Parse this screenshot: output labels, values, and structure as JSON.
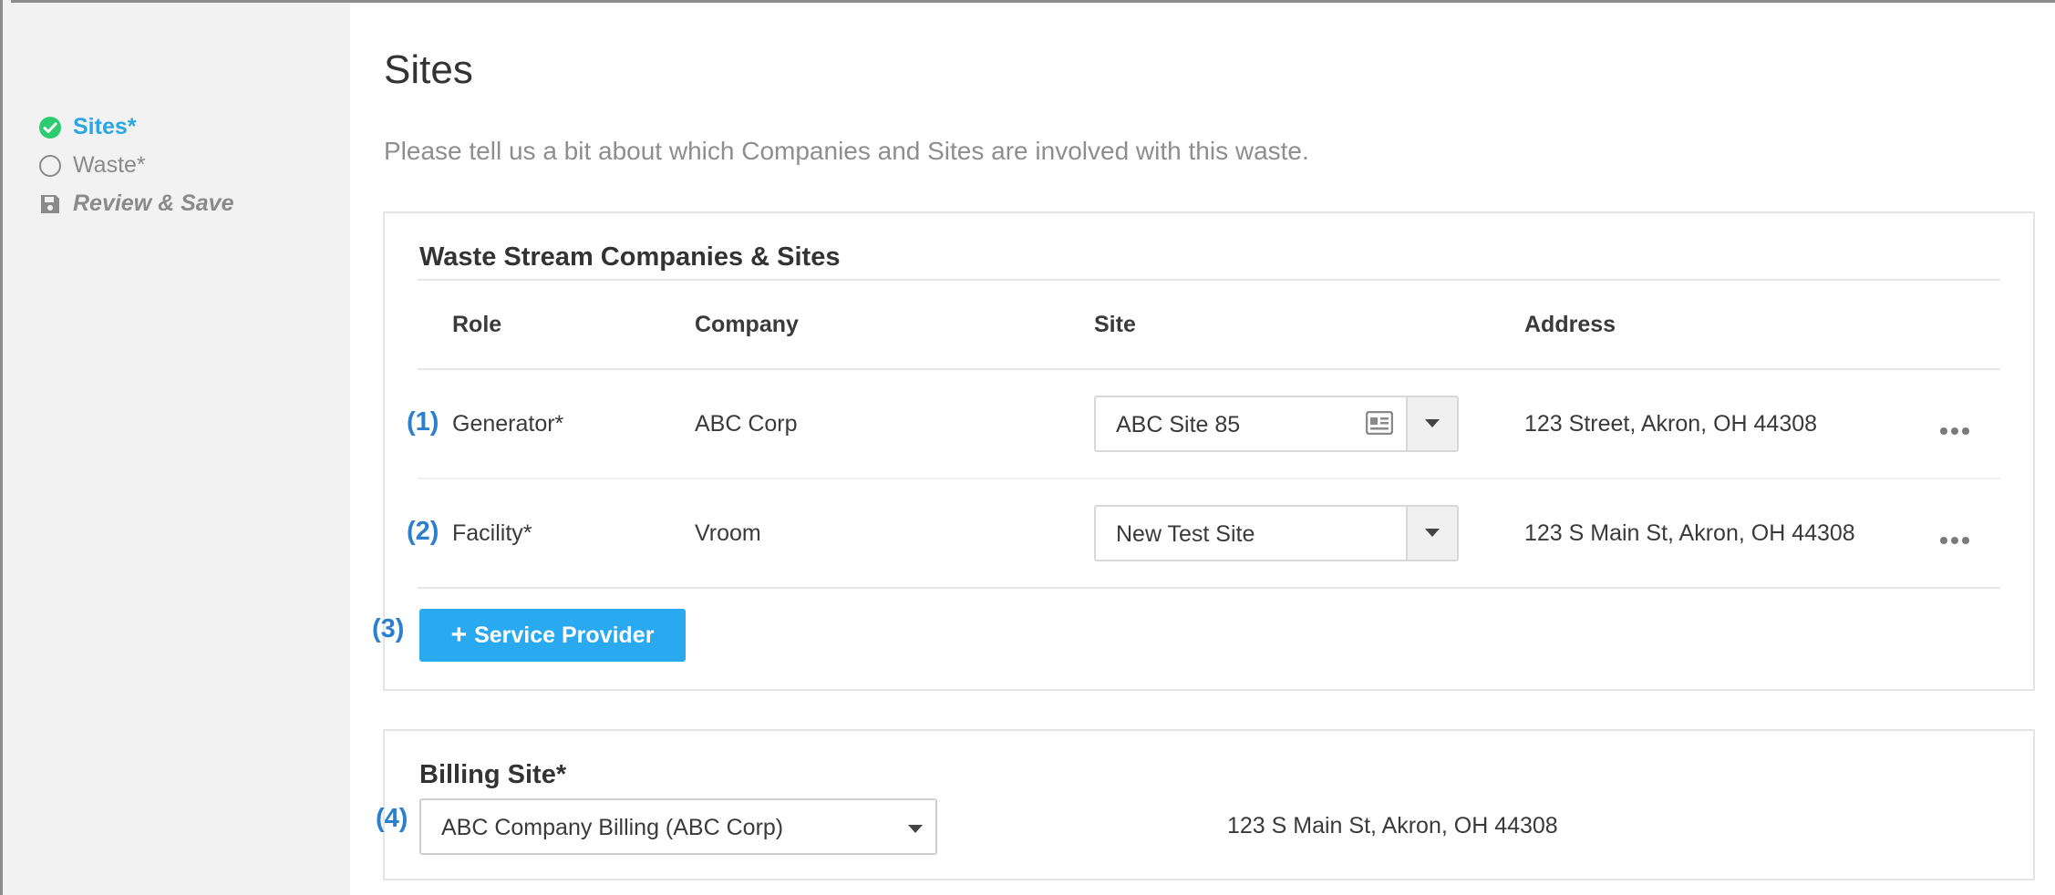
{
  "sidebar": {
    "steps": [
      {
        "label": "Sites*",
        "icon": "check-circle-icon"
      },
      {
        "label": "Waste*",
        "icon": "empty-circle-icon"
      },
      {
        "label": "Review & Save",
        "icon": "save-icon"
      }
    ]
  },
  "page": {
    "title": "Sites",
    "description": "Please tell us a bit about which Companies and Sites are involved with this waste."
  },
  "sites_card": {
    "title": "Waste Stream Companies & Sites",
    "columns": [
      "Role",
      "Company",
      "Site",
      "Address"
    ],
    "rows": [
      {
        "marker": "(1)",
        "role": "Generator*",
        "company": "ABC Corp",
        "site": "ABC Site 85",
        "address": "123 Street, Akron, OH 44308"
      },
      {
        "marker": "(2)",
        "role": "Facility*",
        "company": "Vroom",
        "site": "New Test Site",
        "address": "123 S Main St, Akron, OH 44308"
      }
    ],
    "add_button": {
      "marker": "(3)",
      "plus": "+",
      "label": "Service Provider"
    }
  },
  "billing_card": {
    "title": "Billing Site*",
    "marker": "(4)",
    "selected": "ABC Company Billing (ABC Corp)",
    "address": "123 S Main St, Akron, OH 44308"
  },
  "colors": {
    "accent": "#29a9f0",
    "active_step": "#2aa6e0",
    "check_green": "#2ecc71",
    "marker_blue": "#2a7fcf"
  }
}
